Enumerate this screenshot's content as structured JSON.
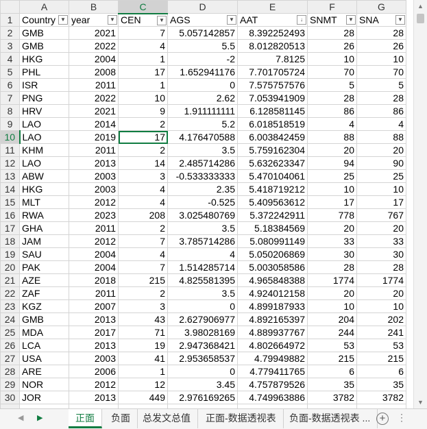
{
  "columns": [
    "A",
    "B",
    "C",
    "D",
    "E",
    "F",
    "G"
  ],
  "selected_column": "C",
  "selected_row": 10,
  "headers": {
    "country": "Country",
    "year": "year",
    "cen": "CEN",
    "ags": "AGS",
    "aat": "AAT",
    "snmt": "SNMT",
    "sna": "SNA"
  },
  "filter_icons": {
    "normal": "filter-dropdown-icon",
    "sorted": "sort-descending-filter-icon"
  },
  "rows": [
    {
      "n": "2",
      "country": "GMB",
      "year": "2021",
      "cen": "7",
      "ags": "5.057142857",
      "aat": "8.392252493",
      "snmt": "28",
      "sna": "28"
    },
    {
      "n": "3",
      "country": "GMB",
      "year": "2022",
      "cen": "4",
      "ags": "5.5",
      "aat": "8.012820513",
      "snmt": "26",
      "sna": "26"
    },
    {
      "n": "4",
      "country": "HKG",
      "year": "2004",
      "cen": "1",
      "ags": "-2",
      "aat": "7.8125",
      "snmt": "10",
      "sna": "10"
    },
    {
      "n": "5",
      "country": "PHL",
      "year": "2008",
      "cen": "17",
      "ags": "1.652941176",
      "aat": "7.701705724",
      "snmt": "70",
      "sna": "70"
    },
    {
      "n": "6",
      "country": "ISR",
      "year": "2011",
      "cen": "1",
      "ags": "0",
      "aat": "7.575757576",
      "snmt": "5",
      "sna": "5"
    },
    {
      "n": "7",
      "country": "PNG",
      "year": "2022",
      "cen": "10",
      "ags": "2.62",
      "aat": "7.053941909",
      "snmt": "28",
      "sna": "28"
    },
    {
      "n": "8",
      "country": "HRV",
      "year": "2021",
      "cen": "9",
      "ags": "1.911111111",
      "aat": "6.128581145",
      "snmt": "86",
      "sna": "86"
    },
    {
      "n": "9",
      "country": "LAO",
      "year": "2014",
      "cen": "2",
      "ags": "5.2",
      "aat": "6.018518519",
      "snmt": "4",
      "sna": "4"
    },
    {
      "n": "10",
      "country": "LAO",
      "year": "2019",
      "cen": "17",
      "ags": "4.176470588",
      "aat": "6.003842459",
      "snmt": "88",
      "sna": "88"
    },
    {
      "n": "11",
      "country": "KHM",
      "year": "2011",
      "cen": "2",
      "ags": "3.5",
      "aat": "5.759162304",
      "snmt": "20",
      "sna": "20"
    },
    {
      "n": "12",
      "country": "LAO",
      "year": "2013",
      "cen": "14",
      "ags": "2.485714286",
      "aat": "5.632623347",
      "snmt": "94",
      "sna": "90"
    },
    {
      "n": "13",
      "country": "ABW",
      "year": "2003",
      "cen": "3",
      "ags": "-0.533333333",
      "aat": "5.470104061",
      "snmt": "25",
      "sna": "25"
    },
    {
      "n": "14",
      "country": "HKG",
      "year": "2003",
      "cen": "4",
      "ags": "2.35",
      "aat": "5.418719212",
      "snmt": "10",
      "sna": "10"
    },
    {
      "n": "15",
      "country": "MLT",
      "year": "2012",
      "cen": "4",
      "ags": "-0.525",
      "aat": "5.409563612",
      "snmt": "17",
      "sna": "17"
    },
    {
      "n": "16",
      "country": "RWA",
      "year": "2023",
      "cen": "208",
      "ags": "3.025480769",
      "aat": "5.372242911",
      "snmt": "778",
      "sna": "767"
    },
    {
      "n": "17",
      "country": "GHA",
      "year": "2011",
      "cen": "2",
      "ags": "3.5",
      "aat": "5.18384569",
      "snmt": "20",
      "sna": "20"
    },
    {
      "n": "18",
      "country": "JAM",
      "year": "2012",
      "cen": "7",
      "ags": "3.785714286",
      "aat": "5.080991149",
      "snmt": "33",
      "sna": "33"
    },
    {
      "n": "19",
      "country": "SAU",
      "year": "2004",
      "cen": "4",
      "ags": "4",
      "aat": "5.050206869",
      "snmt": "30",
      "sna": "30"
    },
    {
      "n": "20",
      "country": "PAK",
      "year": "2004",
      "cen": "7",
      "ags": "1.514285714",
      "aat": "5.003058586",
      "snmt": "28",
      "sna": "28"
    },
    {
      "n": "21",
      "country": "AZE",
      "year": "2018",
      "cen": "215",
      "ags": "4.825581395",
      "aat": "4.965848388",
      "snmt": "1774",
      "sna": "1774"
    },
    {
      "n": "22",
      "country": "ZAF",
      "year": "2011",
      "cen": "2",
      "ags": "3.5",
      "aat": "4.924012158",
      "snmt": "20",
      "sna": "20"
    },
    {
      "n": "23",
      "country": "KGZ",
      "year": "2007",
      "cen": "3",
      "ags": "0",
      "aat": "4.899187933",
      "snmt": "10",
      "sna": "10"
    },
    {
      "n": "24",
      "country": "GMB",
      "year": "2013",
      "cen": "43",
      "ags": "2.627906977",
      "aat": "4.892165397",
      "snmt": "204",
      "sna": "202"
    },
    {
      "n": "25",
      "country": "MDA",
      "year": "2017",
      "cen": "71",
      "ags": "3.98028169",
      "aat": "4.889937767",
      "snmt": "244",
      "sna": "241"
    },
    {
      "n": "26",
      "country": "LCA",
      "year": "2013",
      "cen": "19",
      "ags": "2.947368421",
      "aat": "4.802664972",
      "snmt": "53",
      "sna": "53"
    },
    {
      "n": "27",
      "country": "USA",
      "year": "2003",
      "cen": "41",
      "ags": "2.953658537",
      "aat": "4.79949882",
      "snmt": "215",
      "sna": "215"
    },
    {
      "n": "28",
      "country": "ARE",
      "year": "2006",
      "cen": "1",
      "ags": "0",
      "aat": "4.779411765",
      "snmt": "6",
      "sna": "6"
    },
    {
      "n": "29",
      "country": "NOR",
      "year": "2012",
      "cen": "12",
      "ags": "3.45",
      "aat": "4.757879526",
      "snmt": "35",
      "sna": "35"
    },
    {
      "n": "30",
      "country": "JOR",
      "year": "2013",
      "cen": "449",
      "ags": "2.976169265",
      "aat": "4.749963886",
      "snmt": "3782",
      "sna": "3782"
    }
  ],
  "tabs": [
    {
      "label": "正面",
      "active": true
    },
    {
      "label": "负面",
      "active": false
    },
    {
      "label": "总发文总值",
      "active": false
    },
    {
      "label": "正面-数据透视表",
      "active": false
    },
    {
      "label": "负面-数据透视表 ...",
      "active": false
    }
  ],
  "tab_controls": {
    "add_label": "+",
    "more_label": "⋮",
    "prev_label": "◀",
    "next_label": "▶"
  },
  "colors": {
    "accent": "#107c41",
    "header_bg": "#efefef",
    "grid": "#d4d4d4"
  }
}
